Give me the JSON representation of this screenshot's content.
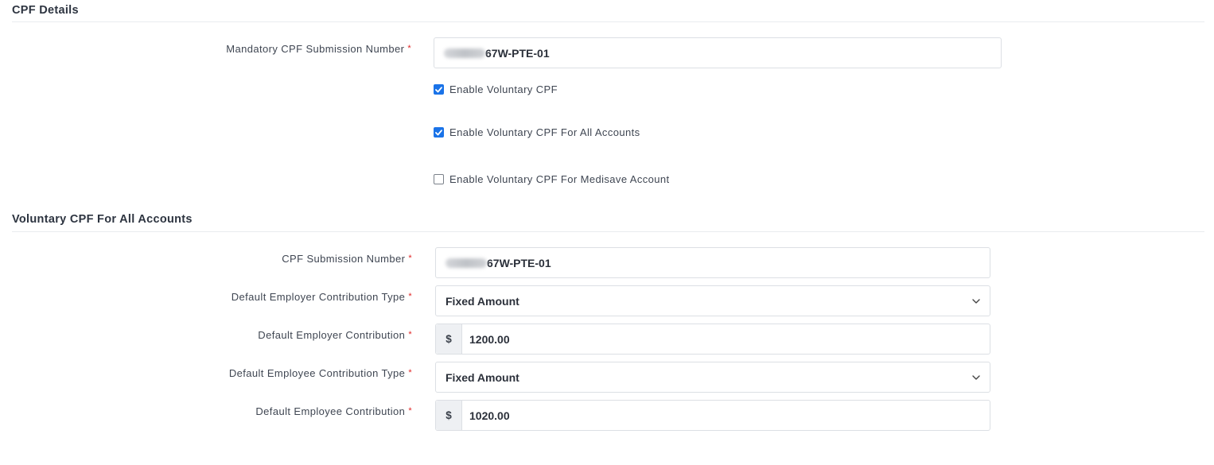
{
  "cpf_details": {
    "title": "CPF Details",
    "mandatory_label": "Mandatory CPF Submission Number",
    "required_mark": "*",
    "mandatory_value_suffix": "67W-PTE-01",
    "checkboxes": [
      {
        "label": "Enable Voluntary CPF",
        "checked": true
      },
      {
        "label": "Enable Voluntary CPF For All Accounts",
        "checked": true
      },
      {
        "label": "Enable Voluntary CPF For Medisave Account",
        "checked": false
      }
    ]
  },
  "voluntary": {
    "title": "Voluntary CPF For All Accounts",
    "submission_label": "CPF Submission Number",
    "submission_value_suffix": "67W-PTE-01",
    "employer_type_label": "Default Employer Contribution Type",
    "employer_type_value": "Fixed Amount",
    "employer_contribution_label": "Default Employer Contribution",
    "currency_prefix": "$",
    "employer_contribution_value": "1200.00",
    "employee_type_label": "Default Employee Contribution Type",
    "employee_type_value": "Fixed Amount",
    "employee_contribution_label": "Default Employee Contribution",
    "employee_contribution_value": "1020.00"
  },
  "colors": {
    "accent": "#1a73e8",
    "required": "#e02424"
  }
}
